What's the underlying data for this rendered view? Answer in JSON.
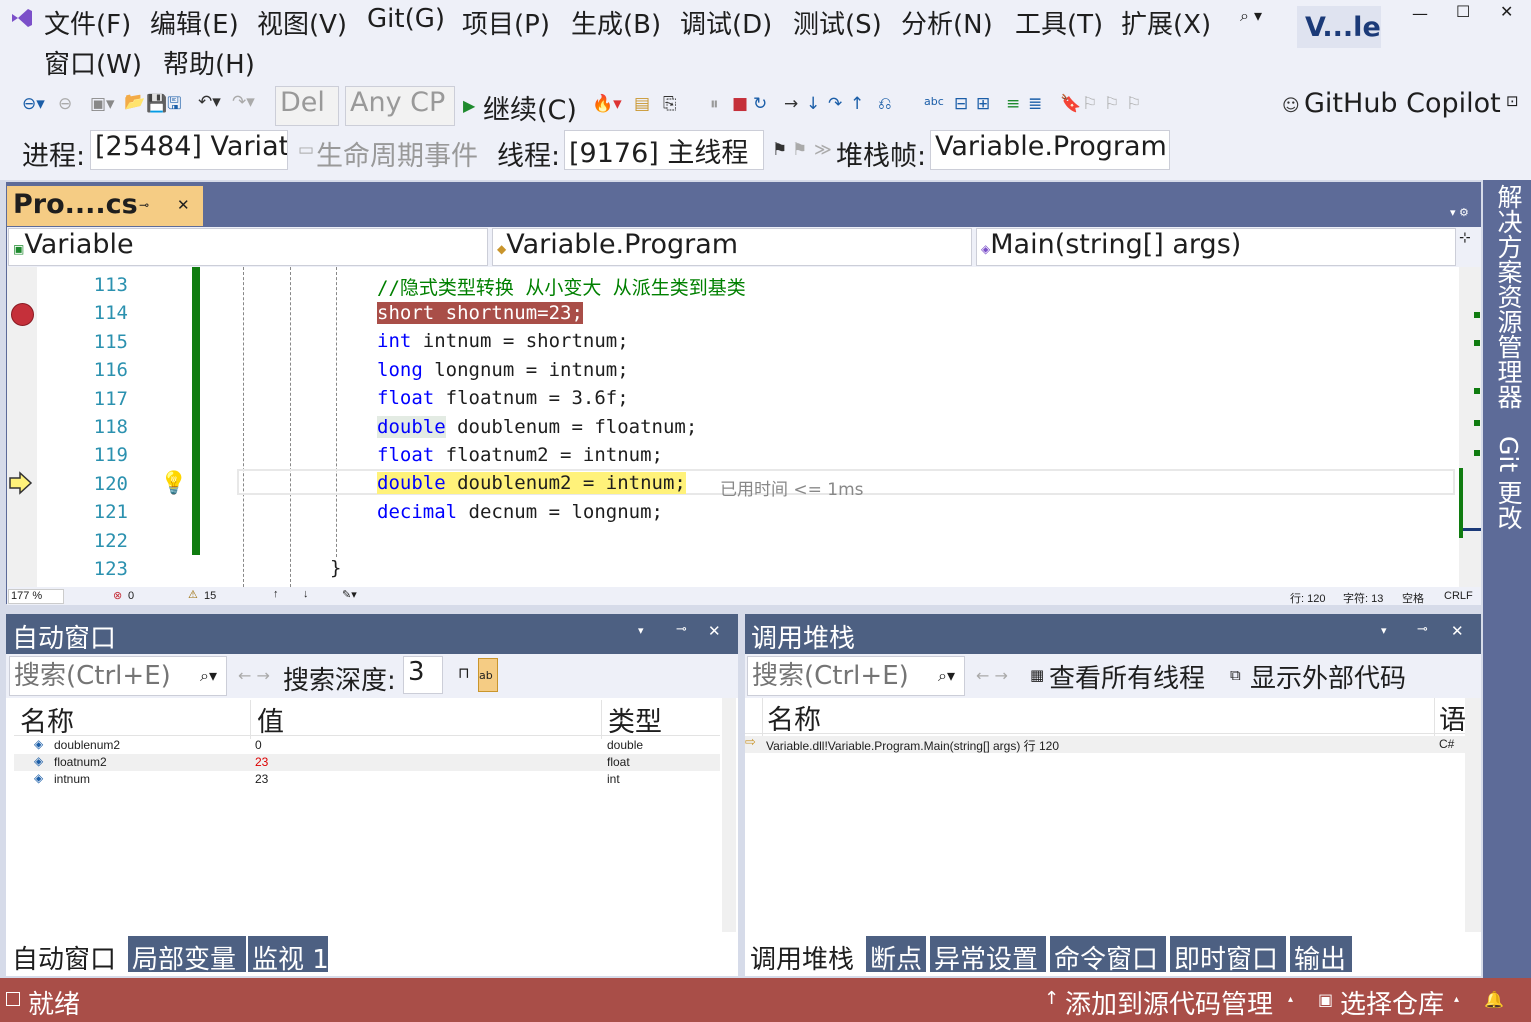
{
  "menu": {
    "row1": [
      "文件(F)",
      "编辑(E)",
      "视图(V)",
      "Git(G)",
      "项目(P)",
      "生成(B)",
      "调试(D)",
      "测试(S)",
      "分析(N)",
      "工具(T)",
      "扩展(X)"
    ],
    "row2": [
      "窗口(W)",
      "帮助(H)"
    ],
    "title": "V...le",
    "search_icon": "search-icon"
  },
  "toolbar": {
    "config": "Del",
    "platform": "Any CP",
    "continue": "继续(C)",
    "copilot": "GitHub Copilot"
  },
  "debug_bar": {
    "process_label": "进程:",
    "process_value": "[25484] Variat",
    "lifecycle": "生命周期事件",
    "thread_label": "线程:",
    "thread_value": "[9176] 主线程",
    "stack_label": "堆栈帧:",
    "stack_value": "Variable.Program"
  },
  "editor": {
    "tab": "Pro....cs",
    "nav1": "Variable",
    "nav2": "Variable.Program",
    "nav3": "Main(string[] args)",
    "line_numbers": [
      "113",
      "114",
      "115",
      "116",
      "117",
      "118",
      "119",
      "120",
      "121",
      "122",
      "123"
    ],
    "comment": "//隐式类型转换 从小变大 从派生类到基类",
    "lines": [
      {
        "kw": "short",
        "rest": " shortnum=23;"
      },
      {
        "kw": "int",
        "rest": " intnum = shortnum;"
      },
      {
        "kw": "long",
        "rest": " longnum = intnum;"
      },
      {
        "kw": "float",
        "rest": " floatnum = 3.6f;"
      },
      {
        "kw": "double",
        "rest": " doublenum = floatnum;"
      },
      {
        "kw": "float",
        "rest": " floatnum2 = intnum;"
      },
      {
        "kw": "double",
        "rest": " doublenum2 = intnum;"
      },
      {
        "kw": "decimal",
        "rest": " decnum = longnum;"
      }
    ],
    "closing_brace": "}",
    "elapsed": "已用时间 <= 1ms",
    "status": {
      "zoom": "177 %",
      "errors": "0",
      "warnings": "15",
      "line": "行: 120",
      "char": "字符: 13",
      "space": "空格",
      "eol": "CRLF"
    }
  },
  "side_tabs": [
    "解决方案资源管理器",
    "Git 更改"
  ],
  "autos": {
    "title": "自动窗口",
    "search_placeholder": "搜索(Ctrl+E)",
    "depth_label": "搜索深度:",
    "depth_value": "3",
    "columns": [
      "名称",
      "值",
      "类型"
    ],
    "rows": [
      {
        "name": "doublenum2",
        "value": "0",
        "type": "double",
        "changed": false
      },
      {
        "name": "floatnum2",
        "value": "23",
        "type": "float",
        "changed": true
      },
      {
        "name": "intnum",
        "value": "23",
        "type": "int",
        "changed": false
      }
    ],
    "tabs": [
      "自动窗口",
      "局部变量",
      "监视 1"
    ]
  },
  "callstack": {
    "title": "调用堆栈",
    "search_placeholder": "搜索(Ctrl+E)",
    "view_threads": "查看所有线程",
    "show_external": "显示外部代码",
    "columns": [
      "名称",
      "语"
    ],
    "rows": [
      {
        "name": "Variable.dll!Variable.Program.Main(string[] args) 行 120",
        "lang": "C#"
      }
    ],
    "tabs": [
      "调用堆栈",
      "断点",
      "异常设置",
      "命令窗口",
      "即时窗口",
      "输出"
    ]
  },
  "statusbar": {
    "ready": "就绪",
    "add_source": "添加到源代码管理",
    "select_repo": "选择仓库"
  },
  "colors": {
    "accent": "#4d6082",
    "status": "#a94e48",
    "breakpoint": "#c5303a",
    "current_line": "#fff27a"
  }
}
